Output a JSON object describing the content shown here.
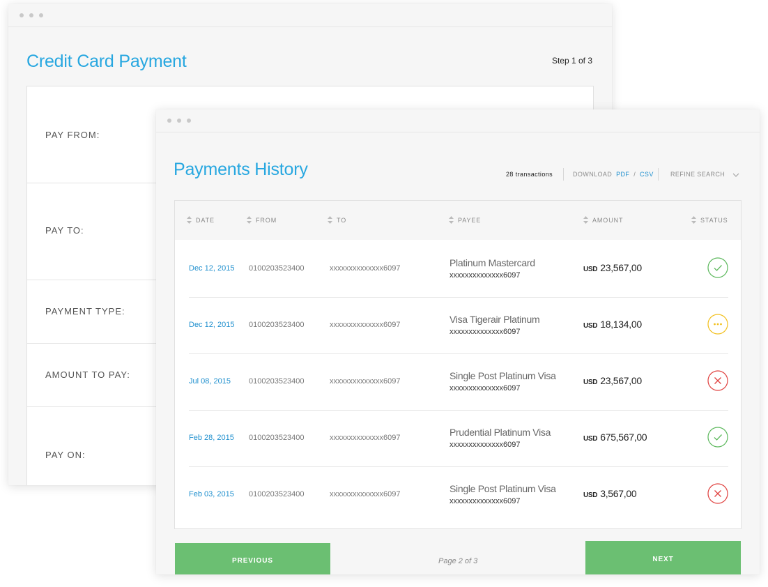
{
  "back_window": {
    "title": "Credit Card Payment",
    "step": "Step 1 of 3",
    "form_labels": [
      "PAY FROM:",
      "PAY TO:",
      "PAYMENT TYPE:",
      "AMOUNT TO PAY:",
      "PAY ON:"
    ]
  },
  "front_window": {
    "title": "Payments History",
    "transactions_count": "28 transactions",
    "download_label": "DOWNLOAD",
    "pdf_label": "PDF",
    "slash": "/",
    "csv_label": "CSV",
    "refine_label": "REFINE SEARCH",
    "columns": [
      "DATE",
      "FROM",
      "TO",
      "PAYEE",
      "AMOUNT",
      "STATUS"
    ],
    "rows": [
      {
        "date": "Dec 12, 2015",
        "from": "0100203523400",
        "to": "xxxxxxxxxxxxxx6097",
        "payee": "Platinum Mastercard",
        "payee_account": "xxxxxxxxxxxxxx6097",
        "currency": "USD",
        "amount": "23,567,00",
        "status": "success"
      },
      {
        "date": "Dec 12, 2015",
        "from": "0100203523400",
        "to": "xxxxxxxxxxxxxx6097",
        "payee": "Visa Tigerair Platinum",
        "payee_account": "xxxxxxxxxxxxxx6097",
        "currency": "USD",
        "amount": "18,134,00",
        "status": "pending"
      },
      {
        "date": "Jul 08, 2015",
        "from": "0100203523400",
        "to": "xxxxxxxxxxxxxx6097",
        "payee": "Single Post Platinum Visa",
        "payee_account": "xxxxxxxxxxxxxx6097",
        "currency": "USD",
        "amount": "23,567,00",
        "status": "failed"
      },
      {
        "date": "Feb 28, 2015",
        "from": "0100203523400",
        "to": "xxxxxxxxxxxxxx6097",
        "payee": "Prudential Platinum Visa",
        "payee_account": "xxxxxxxxxxxxxx6097",
        "currency": "USD",
        "amount": "675,567,00",
        "status": "success"
      },
      {
        "date": "Feb 03, 2015",
        "from": "0100203523400",
        "to": "xxxxxxxxxxxxxx6097",
        "payee": "Single Post Platinum Visa",
        "payee_account": "xxxxxxxxxxxxxx6097",
        "currency": "USD",
        "amount": "3,567,00",
        "status": "failed"
      }
    ],
    "previous_label": "PREVIOUS",
    "page_indicator": "Page 2 of 3",
    "next_label": "NEXT"
  },
  "colors": {
    "accent": "#27a7e0",
    "link": "#1e8fce",
    "button": "#6bbf72",
    "status_success": "#5cb85c",
    "status_pending": "#f2c01e",
    "status_failed": "#e0413f"
  },
  "icons": {
    "status_success": "check-circle-icon",
    "status_pending": "ellipsis-circle-icon",
    "status_failed": "x-circle-icon",
    "sort": "sort-arrows-icon",
    "refine": "chevron-down-icon"
  }
}
